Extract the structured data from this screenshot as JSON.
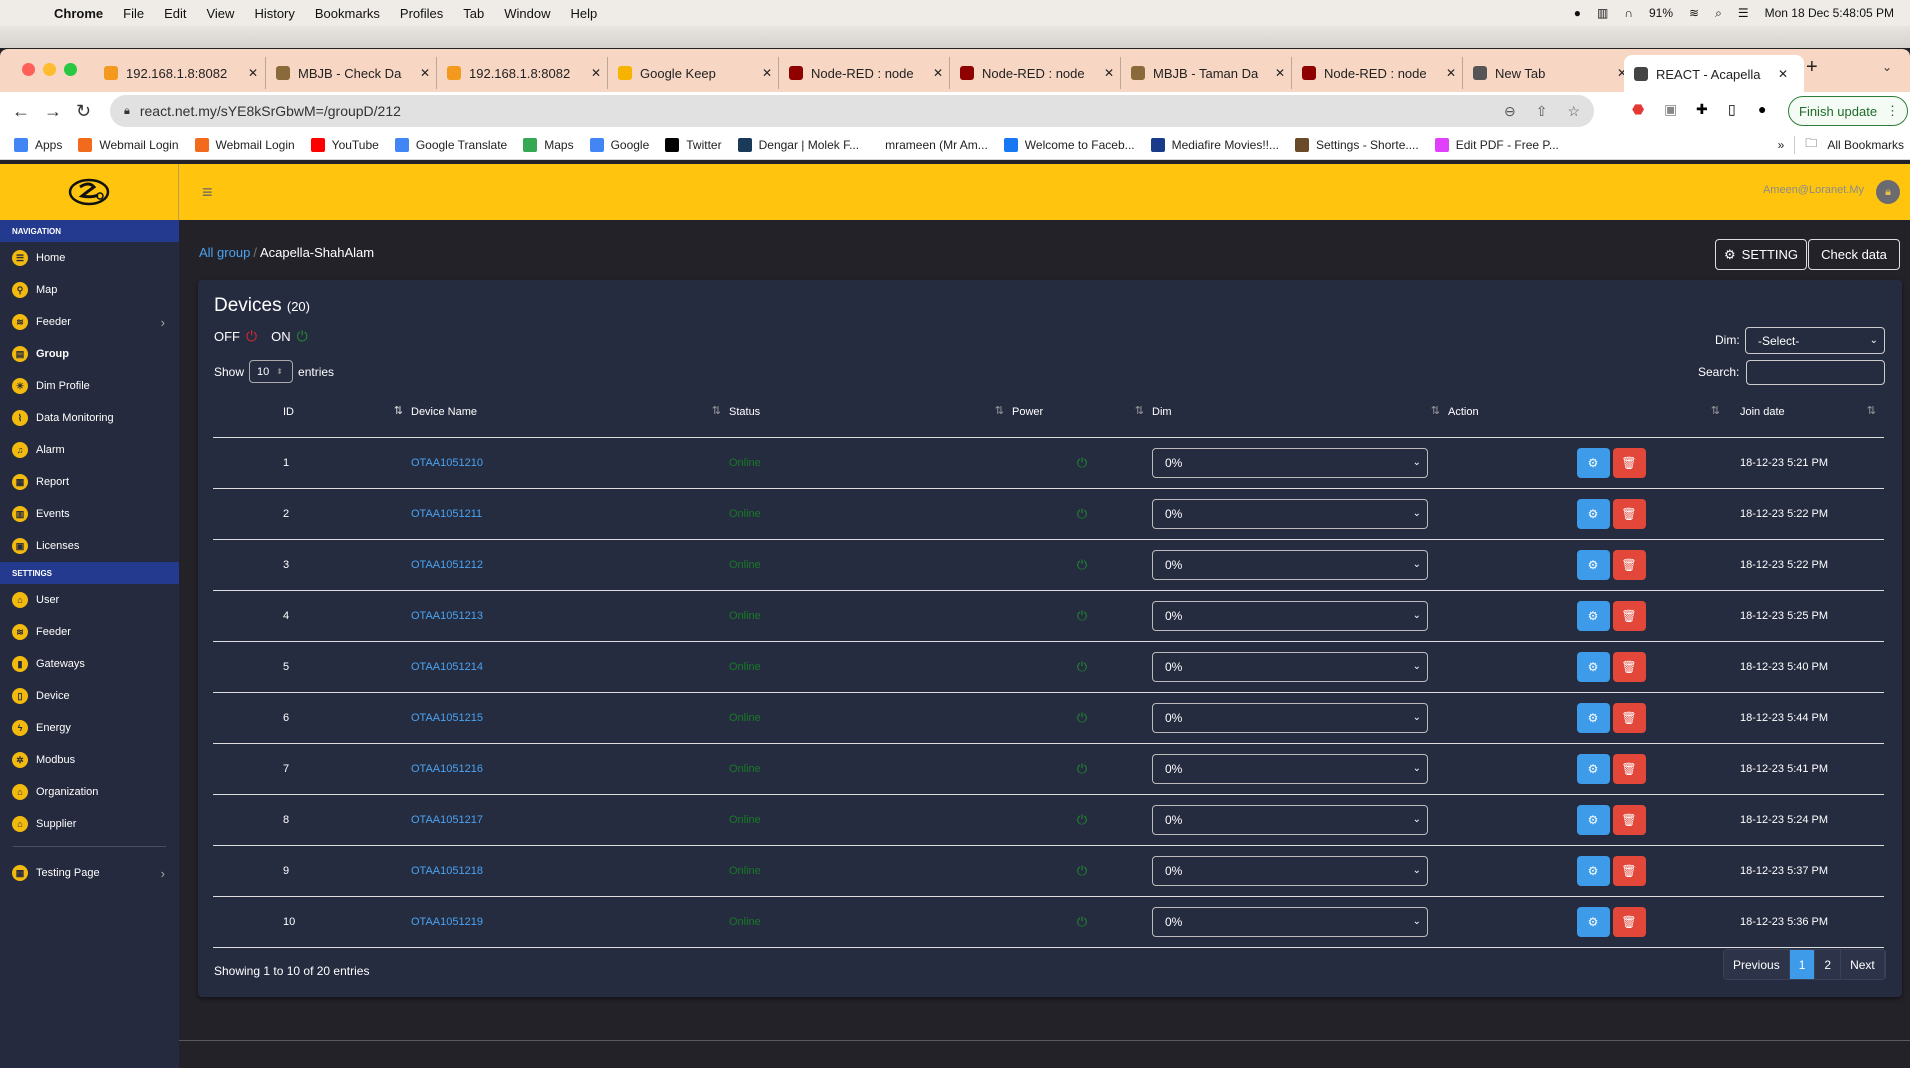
{
  "os_menu": {
    "app": "Chrome",
    "items": [
      "File",
      "Edit",
      "View",
      "History",
      "Bookmarks",
      "Profiles",
      "Tab",
      "Window",
      "Help"
    ],
    "battery": "91%",
    "datetime": "Mon 18 Dec  5:48:05 PM"
  },
  "tabs": [
    {
      "title": "192.168.1.8:8082",
      "icon": "pma-icon",
      "color": "#f39a1e"
    },
    {
      "title": "MBJB - Check Da",
      "icon": "crest-icon",
      "color": "#8a6a3a"
    },
    {
      "title": "192.168.1.8:8082",
      "icon": "pma-icon",
      "color": "#f39a1e"
    },
    {
      "title": "Google Keep",
      "icon": "keep-icon",
      "color": "#f6b400"
    },
    {
      "title": "Node-RED : node",
      "icon": "nodered-icon",
      "color": "#8f0000"
    },
    {
      "title": "Node-RED : node",
      "icon": "nodered-icon",
      "color": "#8f0000"
    },
    {
      "title": "MBJB - Taman Da",
      "icon": "crest-icon",
      "color": "#8a6a3a"
    },
    {
      "title": "Node-RED : node",
      "icon": "nodered-icon",
      "color": "#8f0000"
    },
    {
      "title": "New Tab",
      "icon": "chrome-icon",
      "color": "#555555"
    },
    {
      "title": "REACT - Acapella",
      "icon": "react-icon",
      "color": "#444444",
      "active": true
    }
  ],
  "address": {
    "url": "react.net.my/sYE8kSrGbwM=/groupD/212",
    "finish_update": "Finish update"
  },
  "bookmarks": [
    {
      "label": "Apps",
      "color": "#4285f4"
    },
    {
      "label": "Webmail Login",
      "color": "#f26b1d"
    },
    {
      "label": "Webmail Login",
      "color": "#f26b1d"
    },
    {
      "label": "YouTube",
      "color": "#ff0000"
    },
    {
      "label": "Google Translate",
      "color": "#4285f4"
    },
    {
      "label": "Maps",
      "color": "#34a853"
    },
    {
      "label": "Google",
      "color": "#4285f4"
    },
    {
      "label": "Twitter",
      "color": "#000000"
    },
    {
      "label": "Dengar | Molek F...",
      "color": "#1a3a5a"
    },
    {
      "label": "mrameen (Mr Am...",
      "color": "#ffffff"
    },
    {
      "label": "Welcome to Faceb...",
      "color": "#1877f2"
    },
    {
      "label": "Mediafire Movies!!...",
      "color": "#1a3a8a"
    },
    {
      "label": "Settings - Shorte....",
      "color": "#6b4a2a"
    },
    {
      "label": "Edit PDF - Free P...",
      "color": "#e040fb"
    }
  ],
  "bookmarks_all": "All Bookmarks",
  "header": {
    "user_email": "Ameen@Loranet.My"
  },
  "sidebar": {
    "nav_heading": "NAVIGATION",
    "nav_items": [
      {
        "label": "Home",
        "glyph": "☰"
      },
      {
        "label": "Map",
        "glyph": "⚲"
      },
      {
        "label": "Feeder",
        "glyph": "≋",
        "chevron": true
      },
      {
        "label": "Group",
        "glyph": "▤",
        "active": true
      },
      {
        "label": "Dim Profile",
        "glyph": "☀"
      },
      {
        "label": "Data Monitoring",
        "glyph": "⌇"
      },
      {
        "label": "Alarm",
        "glyph": "♫"
      },
      {
        "label": "Report",
        "glyph": "▦"
      },
      {
        "label": "Events",
        "glyph": "▥"
      },
      {
        "label": "Licenses",
        "glyph": "▣"
      }
    ],
    "settings_heading": "SETTINGS",
    "settings_items": [
      {
        "label": "User",
        "glyph": "⌂"
      },
      {
        "label": "Feeder",
        "glyph": "≋"
      },
      {
        "label": "Gateways",
        "glyph": "▮"
      },
      {
        "label": "Device",
        "glyph": "▯"
      },
      {
        "label": "Energy",
        "glyph": "ϟ"
      },
      {
        "label": "Modbus",
        "glyph": "✲"
      },
      {
        "label": "Organization",
        "glyph": "⌂"
      },
      {
        "label": "Supplier",
        "glyph": "⌂"
      }
    ],
    "extra_items": [
      {
        "label": "Testing Page",
        "glyph": "▦",
        "chevron": true
      }
    ]
  },
  "breadcrumb": {
    "parent": "All group",
    "current": "Acapella-ShahAlam"
  },
  "actions": {
    "setting": "SETTING",
    "check_data": "Check data",
    "tooltip": "Check data"
  },
  "card": {
    "title": "Devices",
    "count": "(20)",
    "legend_off": "OFF",
    "legend_on": "ON",
    "show_label": "Show",
    "page_size": "10",
    "entries_label": "entries",
    "dim_label": "Dim:",
    "dim_value": "-Select-",
    "search_label": "Search:",
    "search_value": ""
  },
  "table": {
    "columns": [
      "ID",
      "Device Name",
      "Status",
      "Power",
      "Dim",
      "Action",
      "Join date"
    ],
    "rows": [
      {
        "id": "1",
        "name": "OTAA1051210",
        "status": "Online",
        "dim": "0%",
        "join": "18-12-23 5:21 PM"
      },
      {
        "id": "2",
        "name": "OTAA1051211",
        "status": "Online",
        "dim": "0%",
        "join": "18-12-23 5:22 PM"
      },
      {
        "id": "3",
        "name": "OTAA1051212",
        "status": "Online",
        "dim": "0%",
        "join": "18-12-23 5:22 PM"
      },
      {
        "id": "4",
        "name": "OTAA1051213",
        "status": "Online",
        "dim": "0%",
        "join": "18-12-23 5:25 PM"
      },
      {
        "id": "5",
        "name": "OTAA1051214",
        "status": "Online",
        "dim": "0%",
        "join": "18-12-23 5:40 PM"
      },
      {
        "id": "6",
        "name": "OTAA1051215",
        "status": "Online",
        "dim": "0%",
        "join": "18-12-23 5:44 PM"
      },
      {
        "id": "7",
        "name": "OTAA1051216",
        "status": "Online",
        "dim": "0%",
        "join": "18-12-23 5:41 PM"
      },
      {
        "id": "8",
        "name": "OTAA1051217",
        "status": "Online",
        "dim": "0%",
        "join": "18-12-23 5:24 PM"
      },
      {
        "id": "9",
        "name": "OTAA1051218",
        "status": "Online",
        "dim": "0%",
        "join": "18-12-23 5:37 PM"
      },
      {
        "id": "10",
        "name": "OTAA1051219",
        "status": "Online",
        "dim": "0%",
        "join": "18-12-23 5:36 PM"
      }
    ]
  },
  "pagination": {
    "info": "Showing 1 to 10 of 20 entries",
    "previous": "Previous",
    "pages": [
      "1",
      "2"
    ],
    "current": "1",
    "next": "Next"
  },
  "colors": {
    "header": "#ffc50e",
    "sidebar": "#252a3e",
    "section": "#233a8e",
    "accent": "#3d9be9",
    "danger": "#e2473a",
    "online": "#167a24"
  }
}
